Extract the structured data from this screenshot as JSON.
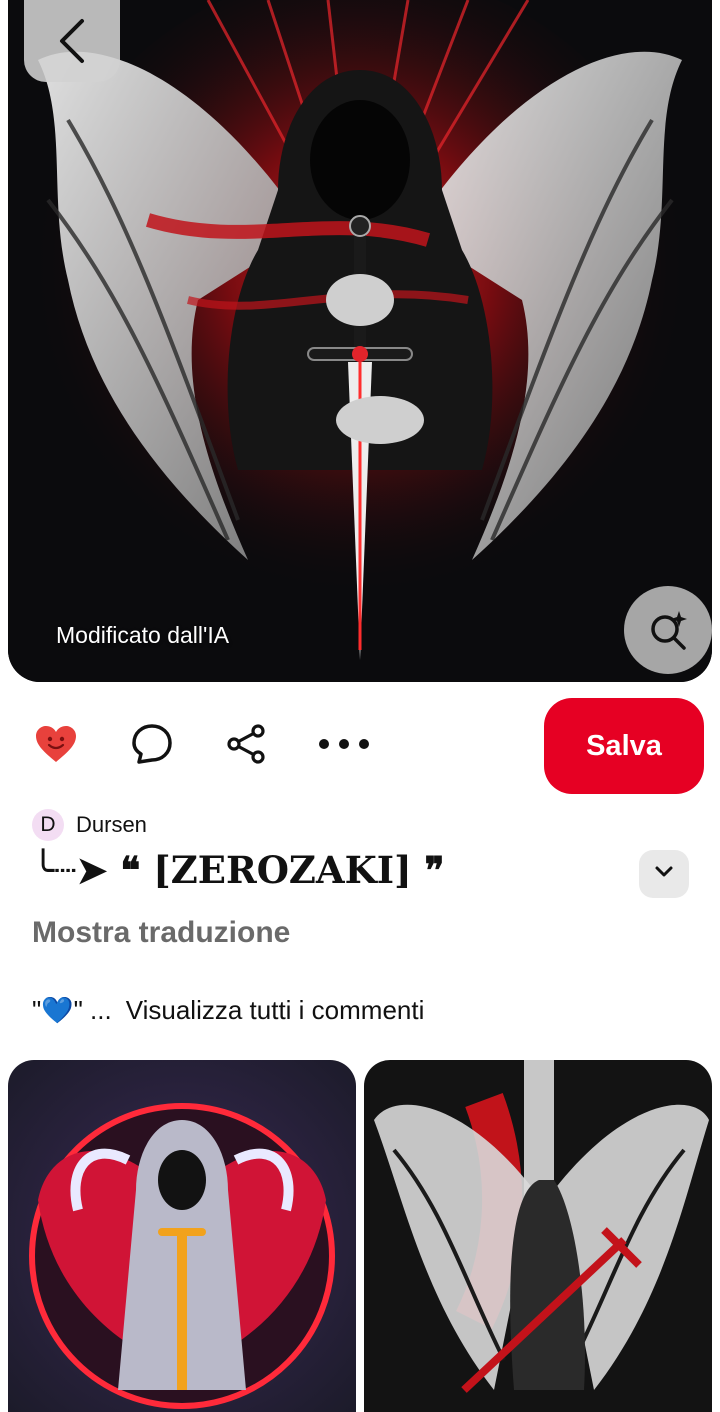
{
  "hero": {
    "ai_label": "Modificato dall'IA"
  },
  "actions": {
    "save_label": "Salva"
  },
  "pin": {
    "author_initial": "D",
    "author_name": "Dursen",
    "title": "╰┈➤ ❝ [ZEROZAKI] ❞",
    "translate_label": "Mostra traduzione",
    "comment_snippet": "\"💙\" ...",
    "view_all_comments": "Visualizza tutti i commenti"
  },
  "colors": {
    "accent": "#e60023",
    "heart": "#e8413c",
    "muted_text": "#6a6a6a",
    "avatar_bg": "#f3ddf3"
  },
  "icons": [
    "back-icon",
    "visual-search-icon",
    "heart-icon",
    "comment-icon",
    "share-icon",
    "more-icon",
    "chevron-down-icon"
  ]
}
